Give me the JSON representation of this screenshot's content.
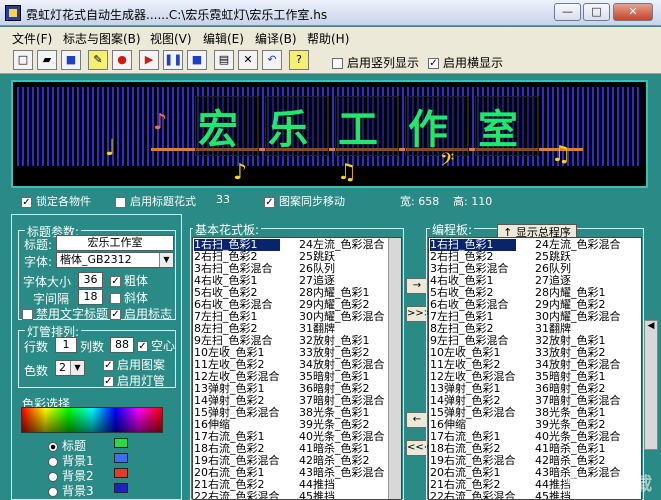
{
  "window": {
    "title": "霓虹灯花式自动生成器......C:\\宏乐霓虹灯\\宏乐工作室.hs"
  },
  "menu": [
    "文件(F)",
    "标志与图案(B)",
    "视图(V)",
    "编辑(E)",
    "编译(B)",
    "帮助(H)"
  ],
  "toolbar": {
    "buttons": [
      {
        "icon": "new-file-icon",
        "glyph": "□"
      },
      {
        "icon": "open-folder-icon",
        "glyph": "▰"
      },
      {
        "icon": "save-icon",
        "glyph": "■"
      },
      {
        "icon": "draw-icon",
        "glyph": "✎"
      },
      {
        "icon": "stop-icon",
        "glyph": "●"
      },
      {
        "icon": "play-icon",
        "glyph": "▶"
      },
      {
        "icon": "pause-icon",
        "glyph": "❚❚"
      },
      {
        "icon": "end-icon",
        "glyph": "■"
      },
      {
        "icon": "edit-icon",
        "glyph": "▤"
      },
      {
        "icon": "tools-icon",
        "glyph": "✕"
      },
      {
        "icon": "undo-icon",
        "glyph": "↶"
      },
      {
        "icon": "help-icon",
        "glyph": "?"
      }
    ],
    "vertical_display": "启用竖列显示",
    "horizontal_display": "启用横显示"
  },
  "stage": {
    "title": "宏乐工作室"
  },
  "stage_bar": {
    "lock": "锁定各物件",
    "enable_title_style": "启用标题花式",
    "title_style_value": "33",
    "sync_pattern": "图案同步移动",
    "width": "宽: 658",
    "height": "高: 110"
  },
  "title_params": {
    "group_label": "标题参数:",
    "title_label": "标题:",
    "title_value": "宏乐工作室",
    "font_label": "字体:",
    "font_value": "楷体_GB2312",
    "font_size_label": "字体大小",
    "font_size_value": "36",
    "spacing_label": "字间隔",
    "spacing_value": "18",
    "bold": "粗体",
    "italic": "斜体",
    "disable_text": "禁用文字标题",
    "enable_logo": "启用标志"
  },
  "tube": {
    "group_label": "灯管排列:",
    "rows_label": "行数",
    "rows_value": "1",
    "cols_label": "列数",
    "cols_value": "88",
    "hollow": "空心",
    "colors_label": "色数",
    "colors_value": "2",
    "enable_pattern": "启用图案",
    "enable_tube": "启用灯管"
  },
  "color_select": {
    "group_label": "色彩选择",
    "items": [
      {
        "label": "标题",
        "color": "#22dd44"
      },
      {
        "label": "背景1",
        "color": "#3a70f0"
      },
      {
        "label": "背景2",
        "color": "#e83a26"
      },
      {
        "label": "背景3",
        "color": "#2020c0"
      }
    ]
  },
  "basic_panel": {
    "label": "基本花式板:",
    "col1": [
      "1右扫_色彩1",
      "2右扫_色彩2",
      "3右扫_色彩混合",
      "4右收_色彩1",
      "5右收_色彩2",
      "6右收_色彩混合",
      "7左扫_色彩1",
      "8左扫_色彩2",
      "9左扫_色彩混合",
      "10左收_色彩1",
      "11左收_色彩2",
      "12左收_色彩混合",
      "13弹射_色彩1",
      "14弹射_色彩2",
      "15弹射_色彩混合",
      "16伸缩",
      "17右流_色彩1",
      "18右流_色彩2",
      "19右流_色彩混合",
      "20右流_色彩1",
      "21右流_色彩2",
      "22右流_色彩混合"
    ],
    "col2": [
      "24左流_色彩混合",
      "25跳跃",
      "26队列",
      "27追逐",
      "28内耀_色彩1",
      "29内耀_色彩2",
      "30内耀_色彩混合",
      "31翻牌",
      "32放射_色彩1",
      "33放射_色彩2",
      "34放射_色彩混合",
      "35暗射_色彩1",
      "36暗射_色彩2",
      "37暗射_色彩混合",
      "38光条_色彩1",
      "39光条_色彩2",
      "40光条_色彩混合",
      "41暗杀_色彩1",
      "42暗杀_色彩2",
      "43暗杀_色彩混合",
      "44推挡",
      "45推挡"
    ]
  },
  "edit_panel": {
    "label": "编程板:",
    "show_all": "显示总程序",
    "col1": [
      "1右扫_色彩1",
      "2右扫_色彩2",
      "3右扫_色彩混合",
      "4右收_色彩1",
      "5右收_色彩2",
      "6右收_色彩混合",
      "7左扫_色彩1",
      "8左扫_色彩2",
      "9左扫_色彩混合",
      "10左收_色彩1",
      "11左收_色彩2",
      "12左收_色彩混合",
      "13弹射_色彩1",
      "14弹射_色彩2",
      "15弹射_色彩混合",
      "16伸缩",
      "17右流_色彩1",
      "18右流_色彩2",
      "19右流_色彩混合",
      "20右流_色彩1",
      "21右流_色彩2",
      "22右流_色彩混合"
    ],
    "col2": [
      "24左流_色彩混合",
      "25跳跃",
      "26队列",
      "27追逐",
      "28内耀_色彩1",
      "29内耀_色彩2",
      "30内耀_色彩混合",
      "31翻牌",
      "32放射_色彩1",
      "33放射_色彩2",
      "34放射_色彩混合",
      "35暗射_色彩1",
      "36暗射_色彩2",
      "37暗射_色彩混合",
      "38光条_色彩1",
      "39光条_色彩2",
      "40光条_色彩混合",
      "41暗杀_色彩1",
      "42暗杀_色彩2",
      "43暗杀_色彩混合",
      "44推挡",
      "45推挡"
    ]
  },
  "transfer_buttons": [
    "→",
    ">>>",
    "←",
    "<<<"
  ],
  "watermark": "9553下载"
}
